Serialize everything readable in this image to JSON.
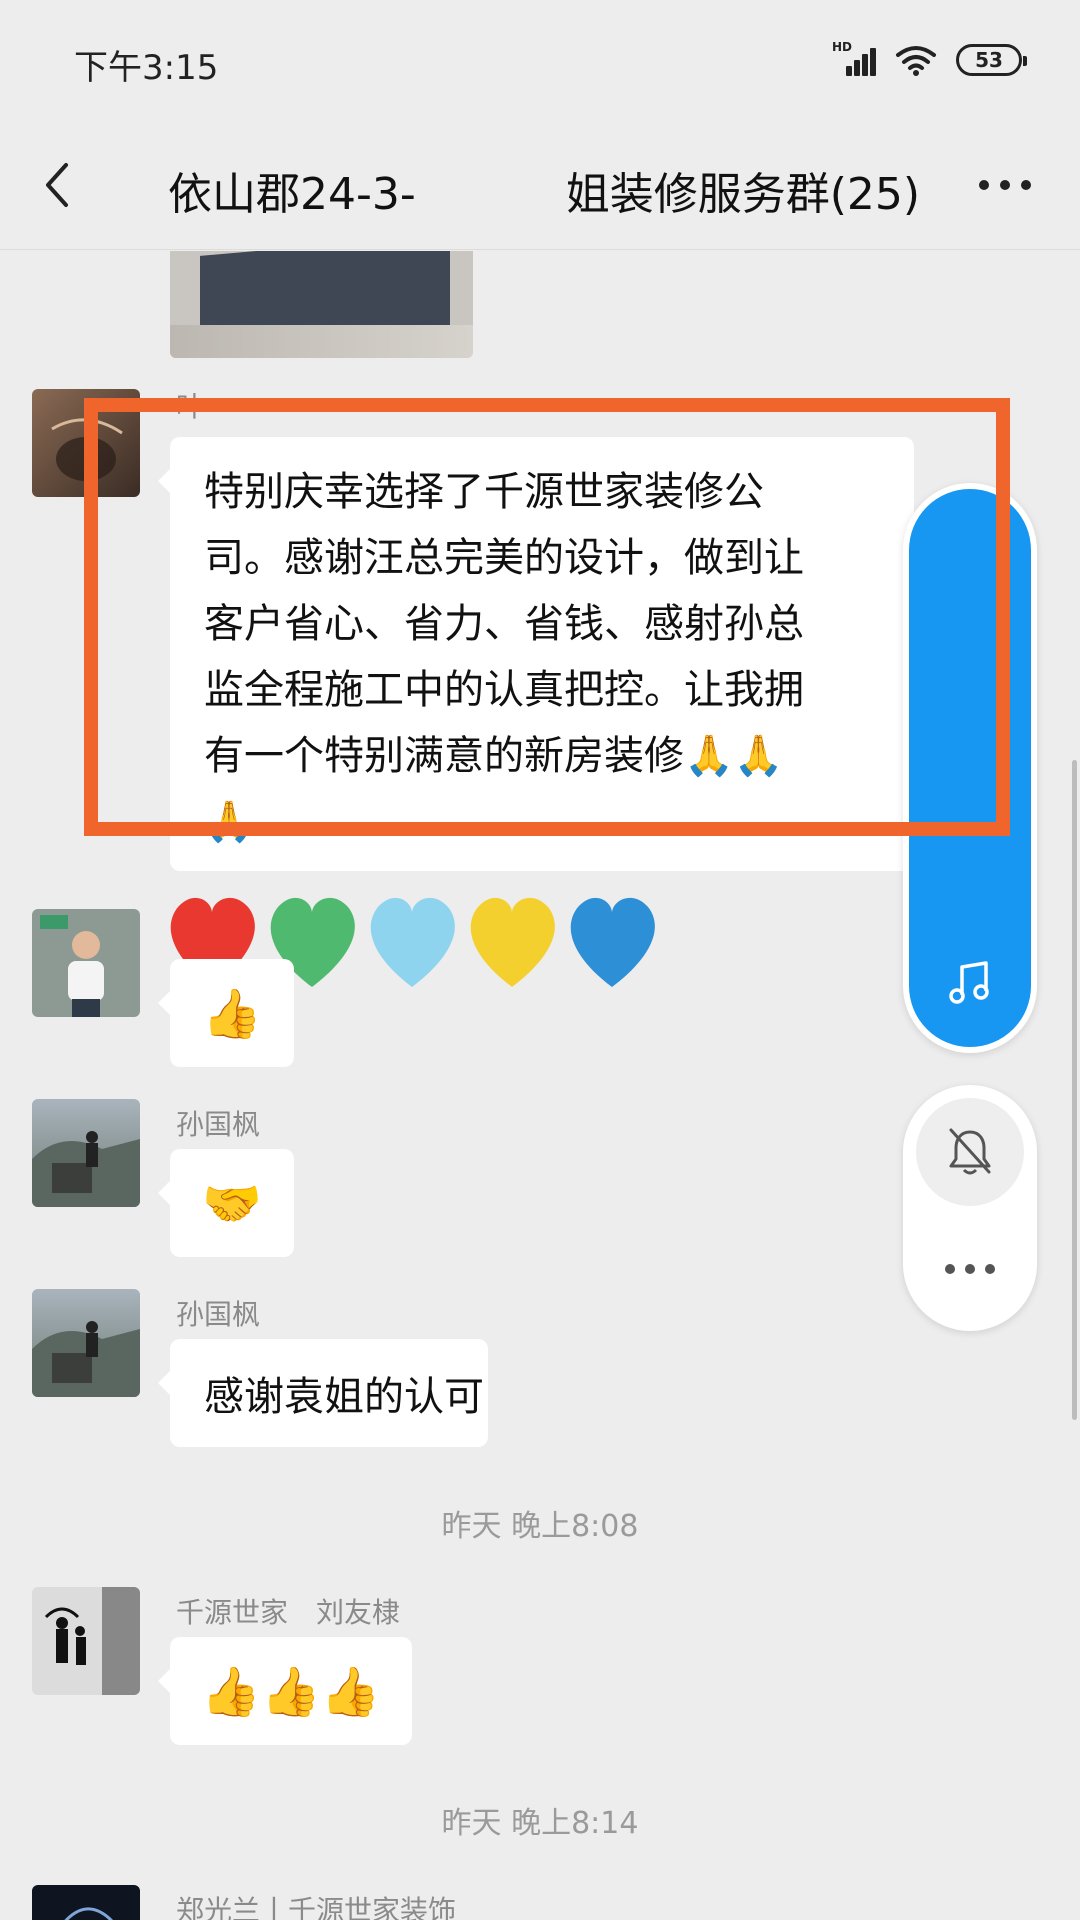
{
  "status_bar": {
    "time": "下午3:15",
    "battery": "53",
    "network": "HD"
  },
  "header": {
    "title_left": "依山郡24-3-",
    "title_right": "姐装修服务群(25)"
  },
  "messages": [
    {
      "id": "m1",
      "sender": "叶",
      "text": "特别庆幸选择了千源世家装修公司。感谢汪总完美的设计，做到让客户省心、省力、省钱、感射孙总监全程施工中的认真把控。让我拥有一个特别满意的新房装修🙏🙏🙏",
      "lines": [
        "特别庆幸选择了千源世家装修公",
        "司。感谢汪总完美的设计，做到让",
        "客户省心、省力、省钱、感射孙总",
        "监全程施工中的认真把控。让我拥",
        "有一个特别满意的新房装修🙏🙏",
        "🙏"
      ]
    },
    {
      "id": "m2",
      "sender": "",
      "text": "👍"
    },
    {
      "id": "m3",
      "sender": "孙国枫",
      "text": "🤝"
    },
    {
      "id": "m4",
      "sender": "孙国枫",
      "text": "感谢袁姐的认可"
    },
    {
      "id": "m5",
      "sender": "千源世家　刘友棣",
      "text": "👍👍👍"
    },
    {
      "id": "m6",
      "sender": "郑光兰丨千源世家装饰"
    }
  ],
  "timestamps": [
    "昨天 晚上8:08",
    "昨天 晚上8:14"
  ],
  "stickers": {
    "hearts": [
      "#e8382f",
      "#4fba6f",
      "#8fd4ee",
      "#f3d02e",
      "#2d8fd6"
    ]
  },
  "colors": {
    "highlight": "#f0652b",
    "float_blue": "#1797f1",
    "background": "#ededed"
  },
  "icons": {
    "back": "chevron-left-icon",
    "more": "more-dots-icon",
    "music": "music-note-icon",
    "bell": "bell-off-icon",
    "float_more": "more-dots-icon"
  }
}
